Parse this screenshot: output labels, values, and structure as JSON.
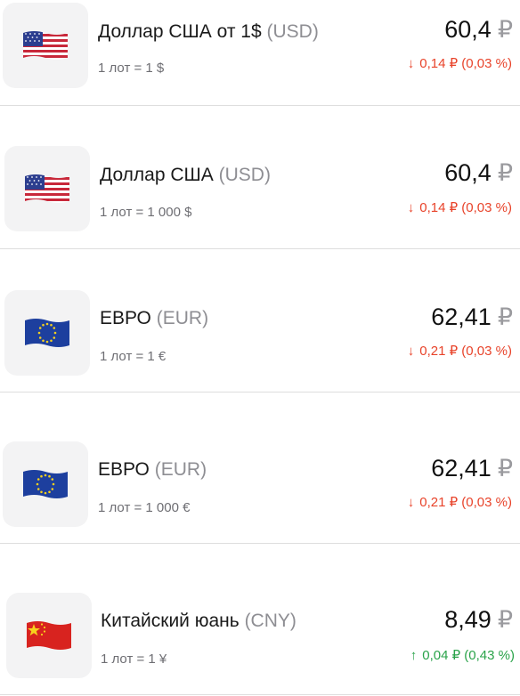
{
  "colors": {
    "down": "#e8432a",
    "up": "#2aa34a",
    "tile_bg": "#f3f3f4"
  },
  "currencies": [
    {
      "flag": "us-flag-icon",
      "name": "Доллар США от 1$",
      "code": "(USD)",
      "lot": "1 лот = 1 $",
      "price": "60,4",
      "currency_symbol": "₽",
      "direction": "down",
      "arrow": "↓",
      "change": "0,14 ₽ (0,03 %)"
    },
    {
      "flag": "us-flag-icon",
      "name": "Доллар США",
      "code": "(USD)",
      "lot": "1 лот = 1 000 $",
      "price": "60,4",
      "currency_symbol": "₽",
      "direction": "down",
      "arrow": "↓",
      "change": "0,14 ₽ (0,03 %)"
    },
    {
      "flag": "eu-flag-icon",
      "name": "ЕВРО",
      "code": "(EUR)",
      "lot": "1 лот = 1 €",
      "price": "62,41",
      "currency_symbol": "₽",
      "direction": "down",
      "arrow": "↓",
      "change": "0,21 ₽ (0,03 %)"
    },
    {
      "flag": "eu-flag-icon",
      "name": "ЕВРО",
      "code": "(EUR)",
      "lot": "1 лот = 1 000 €",
      "price": "62,41",
      "currency_symbol": "₽",
      "direction": "down",
      "arrow": "↓",
      "change": "0,21 ₽ (0,03 %)"
    },
    {
      "flag": "cn-flag-icon",
      "name": "Китайский юань",
      "code": "(CNY)",
      "lot": "1 лот = 1 ¥",
      "price": "8,49",
      "currency_symbol": "₽",
      "direction": "up",
      "arrow": "↑",
      "change": "0,04 ₽ (0,43 %)"
    }
  ]
}
